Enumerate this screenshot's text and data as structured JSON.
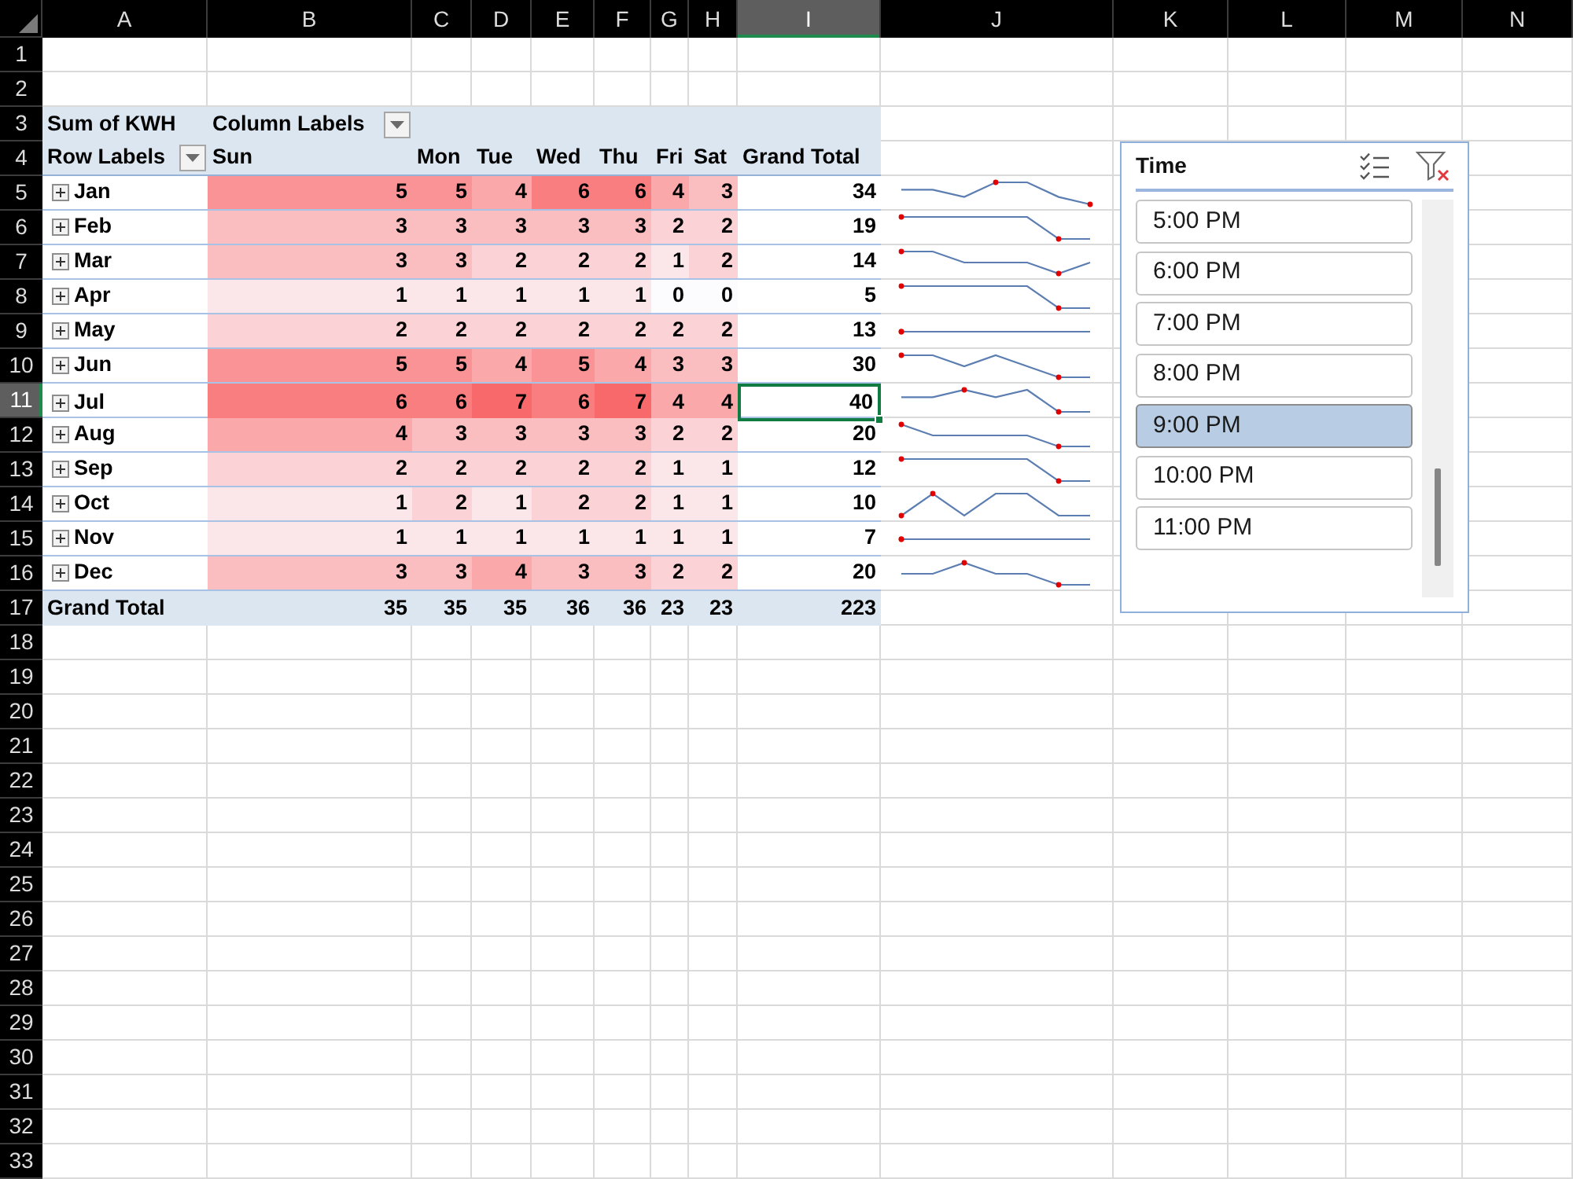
{
  "column_headers": [
    {
      "label": "A",
      "selected": false
    },
    {
      "label": "B",
      "selected": false
    },
    {
      "label": "C",
      "selected": false
    },
    {
      "label": "D",
      "selected": false
    },
    {
      "label": "E",
      "selected": false
    },
    {
      "label": "F",
      "selected": false
    },
    {
      "label": "G",
      "selected": false
    },
    {
      "label": "H",
      "selected": false
    },
    {
      "label": "I",
      "selected": true
    },
    {
      "label": "J",
      "selected": false
    },
    {
      "label": "K",
      "selected": false
    },
    {
      "label": "L",
      "selected": false
    },
    {
      "label": "M",
      "selected": false
    },
    {
      "label": "N",
      "selected": false
    }
  ],
  "row_headers": [
    {
      "label": "1",
      "selected": false
    },
    {
      "label": "2",
      "selected": false
    },
    {
      "label": "3",
      "selected": false
    },
    {
      "label": "4",
      "selected": false
    },
    {
      "label": "5",
      "selected": false
    },
    {
      "label": "6",
      "selected": false
    },
    {
      "label": "7",
      "selected": false
    },
    {
      "label": "8",
      "selected": false
    },
    {
      "label": "9",
      "selected": false
    },
    {
      "label": "10",
      "selected": false
    },
    {
      "label": "11",
      "selected": true
    },
    {
      "label": "12",
      "selected": false
    },
    {
      "label": "13",
      "selected": false
    },
    {
      "label": "14",
      "selected": false
    },
    {
      "label": "15",
      "selected": false
    },
    {
      "label": "16",
      "selected": false
    },
    {
      "label": "17",
      "selected": false
    },
    {
      "label": "18",
      "selected": false
    },
    {
      "label": "19",
      "selected": false
    },
    {
      "label": "20",
      "selected": false
    },
    {
      "label": "21",
      "selected": false
    },
    {
      "label": "22",
      "selected": false
    },
    {
      "label": "23",
      "selected": false
    },
    {
      "label": "24",
      "selected": false
    },
    {
      "label": "25",
      "selected": false
    },
    {
      "label": "26",
      "selected": false
    },
    {
      "label": "27",
      "selected": false
    },
    {
      "label": "28",
      "selected": false
    },
    {
      "label": "29",
      "selected": false
    },
    {
      "label": "30",
      "selected": false
    },
    {
      "label": "31",
      "selected": false
    },
    {
      "label": "32",
      "selected": false
    },
    {
      "label": "33",
      "selected": false
    }
  ],
  "pivot": {
    "value_field": "Sum of KWH",
    "column_field": "Column Labels",
    "row_field": "Row Labels",
    "columns": [
      "Sun",
      "Mon",
      "Tue",
      "Wed",
      "Thu",
      "Fri",
      "Sat"
    ],
    "total_heading": "Grand Total",
    "rows": [
      {
        "label": "Jan",
        "values": [
          "5",
          "5",
          "4",
          "6",
          "6",
          "4",
          "3"
        ],
        "total": "34"
      },
      {
        "label": "Feb",
        "values": [
          "3",
          "3",
          "3",
          "3",
          "3",
          "2",
          "2"
        ],
        "total": "19"
      },
      {
        "label": "Mar",
        "values": [
          "3",
          "3",
          "2",
          "2",
          "2",
          "1",
          "2"
        ],
        "total": "14"
      },
      {
        "label": "Apr",
        "values": [
          "1",
          "1",
          "1",
          "1",
          "1",
          "0",
          "0"
        ],
        "total": "5"
      },
      {
        "label": "May",
        "values": [
          "2",
          "2",
          "2",
          "2",
          "2",
          "2",
          "2"
        ],
        "total": "13"
      },
      {
        "label": "Jun",
        "values": [
          "5",
          "5",
          "4",
          "5",
          "4",
          "3",
          "3"
        ],
        "total": "30"
      },
      {
        "label": "Jul",
        "values": [
          "6",
          "6",
          "7",
          "6",
          "7",
          "4",
          "4"
        ],
        "total": "40"
      },
      {
        "label": "Aug",
        "values": [
          "4",
          "3",
          "3",
          "3",
          "3",
          "2",
          "2"
        ],
        "total": "20"
      },
      {
        "label": "Sep",
        "values": [
          "2",
          "2",
          "2",
          "2",
          "2",
          "1",
          "1"
        ],
        "total": "12"
      },
      {
        "label": "Oct",
        "values": [
          "1",
          "2",
          "1",
          "2",
          "2",
          "1",
          "1"
        ],
        "total": "10"
      },
      {
        "label": "Nov",
        "values": [
          "1",
          "1",
          "1",
          "1",
          "1",
          "1",
          "1"
        ],
        "total": "7"
      },
      {
        "label": "Dec",
        "values": [
          "3",
          "3",
          "4",
          "3",
          "3",
          "2",
          "2"
        ],
        "total": "20"
      }
    ],
    "grand_total": {
      "label": "Grand Total",
      "values": [
        "35",
        "35",
        "35",
        "36",
        "36",
        "23",
        "23"
      ],
      "total": "223"
    }
  },
  "slicer": {
    "title": "Time",
    "items": [
      {
        "label": "5:00 PM",
        "selected": false
      },
      {
        "label": "6:00 PM",
        "selected": false
      },
      {
        "label": "7:00 PM",
        "selected": false
      },
      {
        "label": "8:00 PM",
        "selected": false
      },
      {
        "label": "9:00 PM",
        "selected": true
      },
      {
        "label": "10:00 PM",
        "selected": false
      },
      {
        "label": "11:00 PM",
        "selected": false
      }
    ]
  }
}
